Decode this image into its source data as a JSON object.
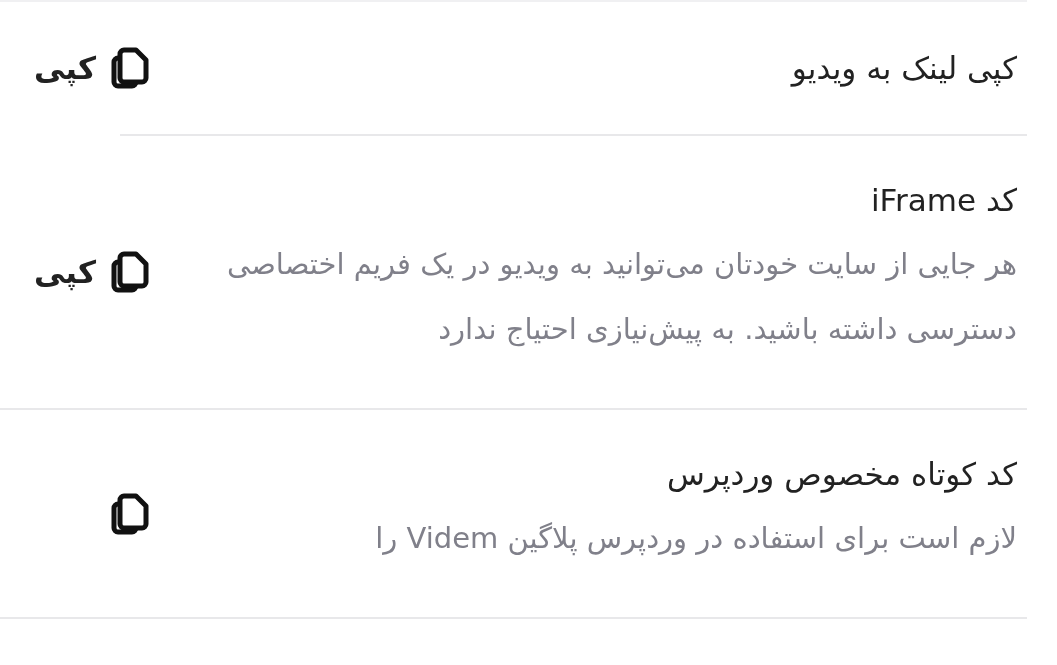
{
  "items": [
    {
      "title": "کپی لینک به ویدیو",
      "copy_label": "کپی"
    },
    {
      "title": "کد iFrame",
      "description": "هر جایی از سایت خودتان می‌توانید به ویدیو در یک فریم اختصاصی دسترسی داشته باشید. به پیش‌نیازی احتیاج ندارد",
      "copy_label": "کپی"
    },
    {
      "title": "کد کوتاه مخصوص وردپرس",
      "description": "لازم است برای استفاده در وردپرس پلاگین Videm را"
    }
  ]
}
